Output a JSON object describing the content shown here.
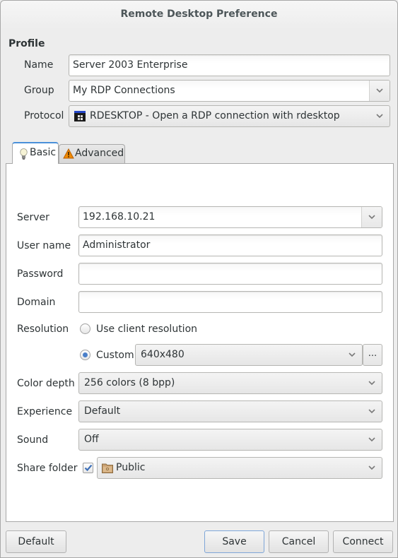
{
  "window": {
    "title": "Remote Desktop Preference"
  },
  "profile": {
    "section_title": "Profile",
    "name": {
      "label": "Name",
      "value": "Server 2003 Enterprise"
    },
    "group": {
      "label": "Group",
      "value": "My RDP Connections"
    },
    "protocol": {
      "label": "Protocol",
      "value": "RDESKTOP - Open a RDP connection with rdesktop",
      "icon": "rdp-protocol-icon"
    }
  },
  "tabs": [
    {
      "label": "Basic",
      "icon": "lightbulb-icon",
      "active": true
    },
    {
      "label": "Advanced",
      "icon": "warning-icon",
      "active": false
    }
  ],
  "basic": {
    "server": {
      "label": "Server",
      "value": "192.168.10.21"
    },
    "username": {
      "label": "User name",
      "value": "Administrator"
    },
    "password": {
      "label": "Password",
      "value": ""
    },
    "domain": {
      "label": "Domain",
      "value": ""
    },
    "resolution": {
      "label": "Resolution",
      "options": [
        {
          "label": "Use client resolution",
          "checked": false
        },
        {
          "label": "Custom",
          "checked": true
        }
      ],
      "custom_value": "640x480",
      "more_button": "..."
    },
    "color_depth": {
      "label": "Color depth",
      "value": "256 colors (8 bpp)"
    },
    "experience": {
      "label": "Experience",
      "value": "Default"
    },
    "sound": {
      "label": "Sound",
      "value": "Off"
    },
    "share_folder": {
      "label": "Share folder",
      "checked": true,
      "value": "Public",
      "icon": "folder-icon"
    }
  },
  "buttons": {
    "default": "Default",
    "save": "Save",
    "cancel": "Cancel",
    "connect": "Connect"
  },
  "colors": {
    "accent": "#4a90d9",
    "radio_selected": "#4a7fc9",
    "check": "#3d6fb8"
  }
}
